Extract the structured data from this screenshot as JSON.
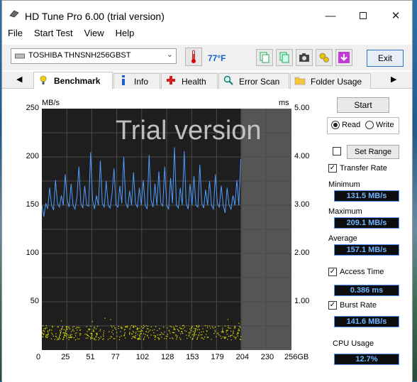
{
  "window": {
    "title": "HD Tune Pro 6.00 (trial version)"
  },
  "menu": [
    "File",
    "Start Test",
    "View",
    "Help"
  ],
  "toolbar": {
    "drive": "TOSHIBA THNSNH256GBST",
    "temperature": "77°F",
    "exit_label": "Exit",
    "icons": [
      "copy-icon",
      "copy-all-icon",
      "camera-icon",
      "options-icon",
      "save-icon"
    ]
  },
  "tabs": [
    {
      "label": "Benchmark",
      "icon": "benchmark-icon",
      "active": true
    },
    {
      "label": "Info",
      "icon": "info-icon",
      "active": false
    },
    {
      "label": "Health",
      "icon": "health-icon",
      "active": false
    },
    {
      "label": "Error Scan",
      "icon": "error-scan-icon",
      "active": false
    },
    {
      "label": "Folder Usage",
      "icon": "folder-icon",
      "active": false
    }
  ],
  "panel": {
    "start_label": "Start",
    "read_label": "Read",
    "write_label": "Write",
    "mode": "read",
    "set_range_label": "Set Range",
    "transfer_rate_label": "Transfer Rate",
    "minimum_label": "Minimum",
    "minimum_value": "131.5 MB/s",
    "maximum_label": "Maximum",
    "maximum_value": "209.1 MB/s",
    "average_label": "Average",
    "average_value": "157.1 MB/s",
    "access_time_label": "Access Time",
    "access_time_value": "0.386 ms",
    "burst_rate_label": "Burst Rate",
    "burst_rate_value": "141.6 MB/s",
    "cpu_usage_label": "CPU Usage",
    "cpu_usage_value": "12.7%"
  },
  "chart_data": {
    "type": "line",
    "watermark": "Trial version",
    "y_left_unit": "MB/s",
    "y_right_unit": "ms",
    "y_left_ticks": [
      "250",
      "200",
      "150",
      "100",
      "50"
    ],
    "y_right_ticks": [
      "5.00",
      "4.00",
      "3.00",
      "2.00",
      "1.00"
    ],
    "x_ticks": [
      "0",
      "25",
      "51",
      "77",
      "102",
      "128",
      "153",
      "179",
      "204",
      "230",
      "256GB"
    ],
    "xlim": [
      0,
      256
    ],
    "ylim_left": [
      0,
      250
    ],
    "ylim_right": [
      0,
      5
    ],
    "tested_range_end": 204,
    "series": [
      {
        "name": "Transfer Rate",
        "color": "#4f9cff",
        "x": [
          0,
          2,
          4,
          6,
          8,
          10,
          12,
          14,
          16,
          18,
          20,
          22,
          24,
          26,
          28,
          30,
          32,
          34,
          36,
          38,
          40,
          42,
          44,
          46,
          48,
          50,
          52,
          54,
          56,
          58,
          60,
          62,
          64,
          66,
          68,
          70,
          72,
          74,
          76,
          78,
          80,
          82,
          84,
          86,
          88,
          90,
          92,
          94,
          96,
          98,
          100,
          102,
          104,
          106,
          108,
          110,
          112,
          114,
          116,
          118,
          120,
          122,
          124,
          126,
          128,
          130,
          132,
          134,
          136,
          138,
          140,
          142,
          144,
          146,
          148,
          150,
          152,
          154,
          156,
          158,
          160,
          162,
          164,
          166,
          168,
          170,
          172,
          174,
          176,
          178,
          180,
          182,
          184,
          186,
          188,
          190,
          192,
          194,
          196,
          198,
          200,
          202,
          204
        ],
        "values": [
          150,
          138,
          152,
          146,
          168,
          150,
          145,
          176,
          152,
          148,
          160,
          150,
          182,
          155,
          148,
          172,
          150,
          146,
          158,
          190,
          152,
          147,
          170,
          150,
          149,
          205,
          155,
          146,
          160,
          150,
          196,
          152,
          148,
          175,
          150,
          147,
          162,
          188,
          150,
          148,
          170,
          152,
          200,
          153,
          147,
          165,
          150,
          184,
          152,
          148,
          168,
          150,
          176,
          150,
          146,
          202,
          155,
          148,
          172,
          150,
          185,
          152,
          149,
          190,
          150,
          146,
          178,
          152,
          210,
          150,
          147,
          168,
          150,
          206,
          152,
          146,
          172,
          150,
          180,
          150,
          148,
          192,
          152,
          147,
          166,
          150,
          175,
          150,
          146,
          182,
          152,
          148,
          170,
          150,
          142,
          168,
          150,
          146,
          160,
          150,
          176,
          150,
          198
        ]
      }
    ],
    "access_time_points_note_color": "#e6e600"
  }
}
